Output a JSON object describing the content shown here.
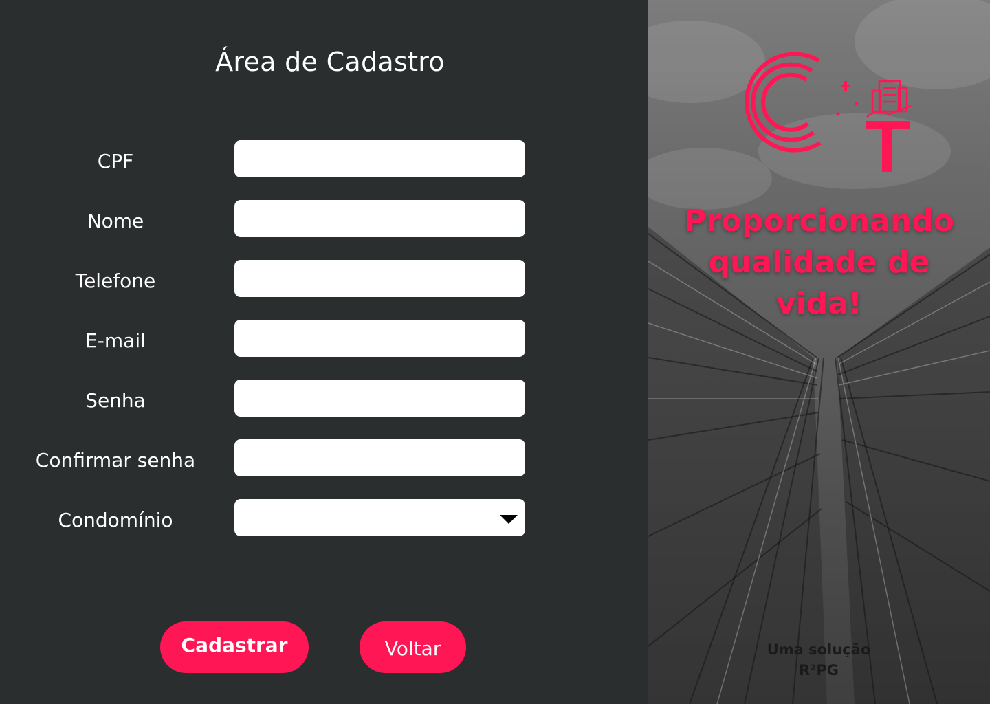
{
  "form": {
    "title": "Área de Cadastro",
    "fields": [
      {
        "label": "CPF",
        "value": ""
      },
      {
        "label": "Nome",
        "value": ""
      },
      {
        "label": "Telefone",
        "value": ""
      },
      {
        "label": "E-mail",
        "value": ""
      },
      {
        "label": "Senha",
        "value": ""
      },
      {
        "label": "Confirmar senha",
        "value": ""
      },
      {
        "label": "Condomínio",
        "value": ""
      }
    ],
    "submit_label": "Cadastrar",
    "back_label": "Voltar"
  },
  "brand": {
    "logo_icon": "ct-building-hand-logo",
    "tagline_line1": "Proporcionando",
    "tagline_line2": "qualidade de",
    "tagline_line3": "vida!",
    "credit_line1": "Uma solução",
    "credit_line2": "R²PG"
  },
  "colors": {
    "accent": "#ff1654",
    "panel_background": "#2b2e2f",
    "input_background": "#ffffff"
  }
}
